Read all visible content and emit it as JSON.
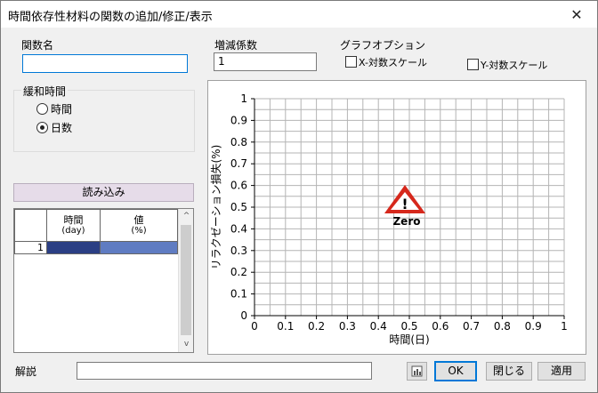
{
  "window": {
    "title": "時間依存性材料の関数の追加/修正/表示",
    "close_glyph": "✕"
  },
  "form": {
    "function_name_label": "関数名",
    "function_name_value": "",
    "coefficient_label": "増減係数",
    "coefficient_value": "1",
    "graph_options_label": "グラフオプション",
    "x_log_label": "X-対数スケール",
    "y_log_label": "Y-対数スケール",
    "relaxation_label": "緩和時間",
    "relax_option_hours": "時間",
    "relax_option_days": "日数",
    "relax_selected": "日数",
    "load_button": "読み込み",
    "description_label": "解説",
    "description_value": ""
  },
  "table": {
    "headers": [
      {
        "line1": "時間",
        "line2": "(day)"
      },
      {
        "line1": "値",
        "line2": "(%)"
      }
    ],
    "rows": [
      {
        "index": "1",
        "time": "",
        "value": ""
      }
    ],
    "scroll_up": "^",
    "scroll_down": "v"
  },
  "buttons": {
    "ok": "OK",
    "close": "閉じる",
    "apply": "適用"
  },
  "chart_data": {
    "type": "line",
    "xlabel": "時間(日)",
    "ylabel": "リラクゼーション損失(%)",
    "xlim": [
      0,
      1
    ],
    "ylim": [
      0,
      1
    ],
    "x_ticks": [
      "0",
      "0.1",
      "0.2",
      "0.3",
      "0.4",
      "0.5",
      "0.6",
      "0.7",
      "0.8",
      "0.9",
      "1"
    ],
    "y_ticks": [
      "0",
      "0.1",
      "0.2",
      "0.3",
      "0.4",
      "0.5",
      "0.6",
      "0.7",
      "0.8",
      "0.9",
      "1"
    ],
    "grid": true,
    "series": [],
    "annotation": "Zero",
    "colors": {
      "warning_red": "#d6281c",
      "selected_cell": "#2b3f84",
      "selected_cell_alt": "#5f7cc2"
    }
  }
}
